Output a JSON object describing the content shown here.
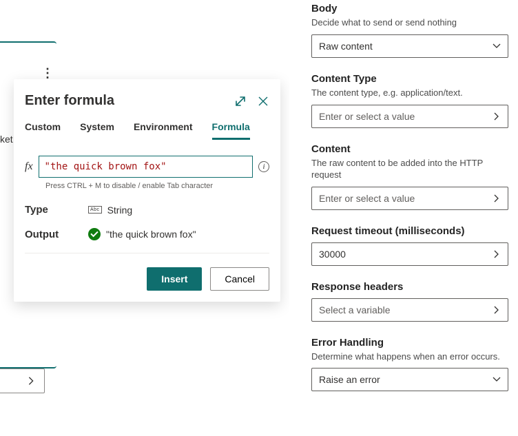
{
  "bg": {
    "ket": "ket"
  },
  "dialog": {
    "title": "Enter formula",
    "tabs": [
      "Custom",
      "System",
      "Environment",
      "Formula"
    ],
    "activeTab": 3,
    "fx": "fx",
    "formulaValue": "\"the quick brown fox\"",
    "hint": "Press CTRL + M to disable / enable Tab character",
    "typeLabel": "Type",
    "typeBadge": "Abc",
    "typeValue": "String",
    "outputLabel": "Output",
    "outputValue": "\"the quick brown fox\"",
    "insert": "Insert",
    "cancel": "Cancel"
  },
  "side": {
    "body": {
      "label": "Body",
      "sub": "Decide what to send or send nothing",
      "value": "Raw content"
    },
    "contentType": {
      "label": "Content Type",
      "sub": "The content type, e.g. application/text.",
      "placeholder": "Enter or select a value"
    },
    "content": {
      "label": "Content",
      "sub": "The raw content to be added into the HTTP request",
      "placeholder": "Enter or select a value"
    },
    "timeout": {
      "label": "Request timeout (milliseconds)",
      "value": "30000"
    },
    "respHeaders": {
      "label": "Response headers",
      "placeholder": "Select a variable"
    },
    "errorHandling": {
      "label": "Error Handling",
      "sub": "Determine what happens when an error occurs.",
      "value": "Raise an error"
    }
  }
}
